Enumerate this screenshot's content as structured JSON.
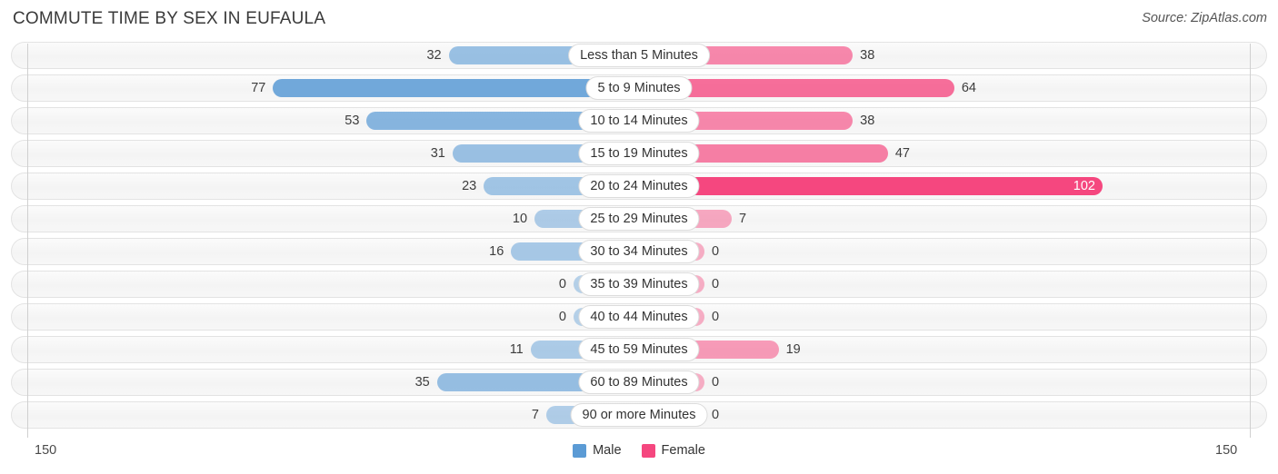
{
  "header": {
    "title": "COMMUTE TIME BY SEX IN EUFAULA",
    "source": "Source: ZipAtlas.com"
  },
  "footer": {
    "axis_max_left": "150",
    "axis_max_right": "150",
    "legend": [
      {
        "label": "Male",
        "color": "#5b9bd5"
      },
      {
        "label": "Female",
        "color": "#f5477f"
      }
    ]
  },
  "chart_data": {
    "type": "bar",
    "title": "COMMUTE TIME BY SEX IN EUFAULA",
    "subtitle": "Source: ZipAtlas.com",
    "orientation": "horizontal-diverging",
    "xlabel": "",
    "ylabel": "",
    "axis_max": 150,
    "xlim": [
      150,
      150
    ],
    "grid": false,
    "legend_position": "bottom-center",
    "categories": [
      "Less than 5 Minutes",
      "5 to 9 Minutes",
      "10 to 14 Minutes",
      "15 to 19 Minutes",
      "20 to 24 Minutes",
      "25 to 29 Minutes",
      "30 to 34 Minutes",
      "35 to 39 Minutes",
      "40 to 44 Minutes",
      "45 to 59 Minutes",
      "60 to 89 Minutes",
      "90 or more Minutes"
    ],
    "series": [
      {
        "name": "Male",
        "color": "#5b9bd5",
        "side": "left",
        "values": [
          32,
          77,
          53,
          31,
          23,
          10,
          16,
          0,
          0,
          11,
          35,
          7
        ]
      },
      {
        "name": "Female",
        "color": "#f5477f",
        "side": "right",
        "values": [
          38,
          64,
          38,
          47,
          102,
          7,
          0,
          0,
          0,
          19,
          0,
          0
        ]
      }
    ]
  }
}
